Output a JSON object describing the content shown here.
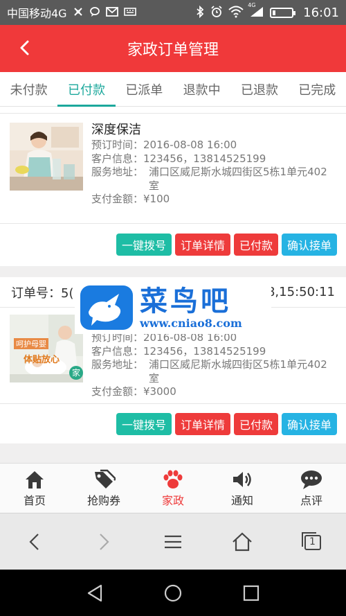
{
  "status_bar": {
    "carrier": "中国移动4G",
    "network_tag": "4G",
    "time": "16:01",
    "battery_level": 0.15
  },
  "header": {
    "title": "家政订单管理"
  },
  "tabs": [
    {
      "label": "未付款",
      "active": false
    },
    {
      "label": "已付款",
      "active": true
    },
    {
      "label": "已派单",
      "active": false
    },
    {
      "label": "退款中",
      "active": false
    },
    {
      "label": "已退款",
      "active": false
    },
    {
      "label": "已完成",
      "active": false
    }
  ],
  "orders": [
    {
      "service_name": "深度保洁",
      "booking_label": "预订时间：",
      "booking_time": "2016-08-08 16:00",
      "customer_label": "客户信息：",
      "customer_info": "123456，13814525199",
      "address_label": "服务地址：",
      "address": "浦口区威尼斯水城四街区5栋1单元402室",
      "amount_label": "支付金额：",
      "amount": "¥100",
      "buttons": [
        "一键拨号",
        "订单详情",
        "已付款",
        "确认接单"
      ]
    },
    {
      "order_no_label": "订单号：",
      "order_no": "5(",
      "order_time": "8,15:50:11",
      "booking_label": "预订时间：",
      "booking_time": "2016-08-08 16:00",
      "customer_label": "客户信息：",
      "customer_info": "123456，13814525199",
      "address_label": "服务地址：",
      "address": "浦口区威尼斯水城四街区5栋1单元402室",
      "amount_label": "支付金额：",
      "amount": "¥3000",
      "image_caption_1": "呵护母婴",
      "image_caption_2": "体贴放心",
      "image_badge": "家",
      "buttons": [
        "一键拨号",
        "订单详情",
        "已付款",
        "确认接单"
      ]
    }
  ],
  "watermark": {
    "title": "菜鸟吧",
    "url": "www.cniao8.com"
  },
  "bottom_nav": [
    {
      "label": "首页",
      "icon": "home-icon",
      "active": false
    },
    {
      "label": "抢购券",
      "icon": "tag-icon",
      "active": false
    },
    {
      "label": "家政",
      "icon": "paw-icon",
      "active": true
    },
    {
      "label": "通知",
      "icon": "speaker-icon",
      "active": false
    },
    {
      "label": "点评",
      "icon": "chat-bubble-icon",
      "active": false
    }
  ],
  "browser_bar": {
    "tab_count": "1"
  },
  "colors": {
    "header_red": "#f0393a",
    "tab_active": "#1ca89c",
    "btn_teal": "#1ebda5",
    "btn_red": "#ee3b3b",
    "btn_blue": "#26b3e3"
  }
}
